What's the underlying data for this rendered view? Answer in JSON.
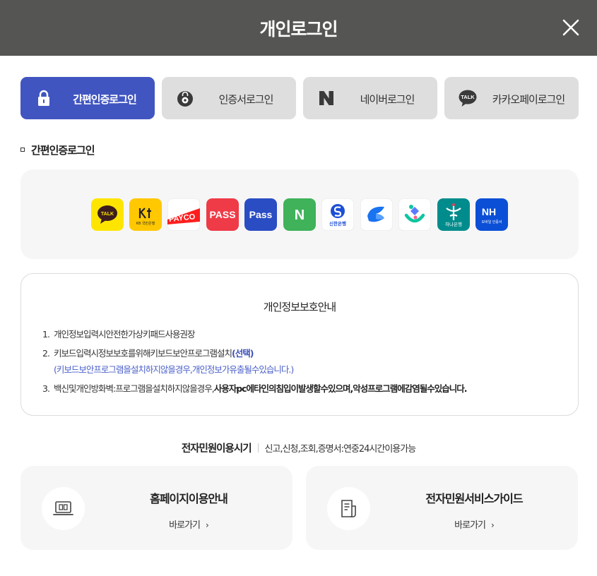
{
  "header": {
    "title": "개인로그인",
    "close_icon": "close-icon"
  },
  "tabs": [
    {
      "label": "간편인증로그인",
      "icon": "lock-icon",
      "active": true
    },
    {
      "label": "인증서로그인",
      "icon": "certificate-icon",
      "active": false
    },
    {
      "label": "네이버로그인",
      "icon": "naver-icon",
      "active": false
    },
    {
      "label": "카카오페이로그인",
      "icon": "kakaotalk-icon",
      "active": false
    }
  ],
  "section_title": "간편인증로그인",
  "providers": [
    {
      "icon": "kakao-talk-icon",
      "text": "TALK",
      "color": "#fee500"
    },
    {
      "icon": "kb-bank-icon",
      "text": "KB 국민은행",
      "color": "#ffc800"
    },
    {
      "icon": "payco-icon",
      "text": "PAYCO",
      "color": "#ff1e1e"
    },
    {
      "icon": "pass-red-icon",
      "text": "PASS",
      "color": "#ee3b47"
    },
    {
      "icon": "pass-blue-icon",
      "text": "Pass",
      "color": "#2a4dc4"
    },
    {
      "icon": "naver-cert-icon",
      "text": "N",
      "color": "#3fb25a"
    },
    {
      "icon": "shinhan-bank-icon",
      "text": "신한은행",
      "color": "#1d4fd6"
    },
    {
      "icon": "toss-icon",
      "text": "",
      "color": "#1a73f0"
    },
    {
      "icon": "bank-salad-icon",
      "text": "",
      "color": "#0ec5a0"
    },
    {
      "icon": "hana-bank-icon",
      "text": "하나은행",
      "color": "#008c8c"
    },
    {
      "icon": "nh-cert-icon",
      "text": "NH",
      "text2": "모바일 인증서",
      "color": "#0b4fd6"
    }
  ],
  "privacy": {
    "title": "개인정보보호안내",
    "items": [
      {
        "num": "1.",
        "text": "개인정보입력시안전한가상키패드사용권장"
      },
      {
        "num": "2.",
        "text": "키보드입력시정보보호를위해키보드보안프로그램설치",
        "emph": "(선택)",
        "sub": "(키보드보안프로그램을설치하지않을경우,개인정보가유출될수있습니다.)"
      },
      {
        "num": "3.",
        "text": "백신및개인방화벽:프로그램을설치하지않을경우,",
        "strong": "사용자pc에타인의침입이발생할수있으며,악성프로그램에감염될수있습니다."
      }
    ]
  },
  "hours": {
    "label": "전자민원이용시기",
    "desc": "신고,신청,조회,증명서:연중24시간이용가능"
  },
  "cards": [
    {
      "title": "홈페이지이용안내",
      "link": "바로가기",
      "arrow": "›",
      "icon": "laptop-icon"
    },
    {
      "title": "전자민원서비스가이드",
      "link": "바로가기",
      "arrow": "›",
      "icon": "document-guide-icon"
    }
  ]
}
